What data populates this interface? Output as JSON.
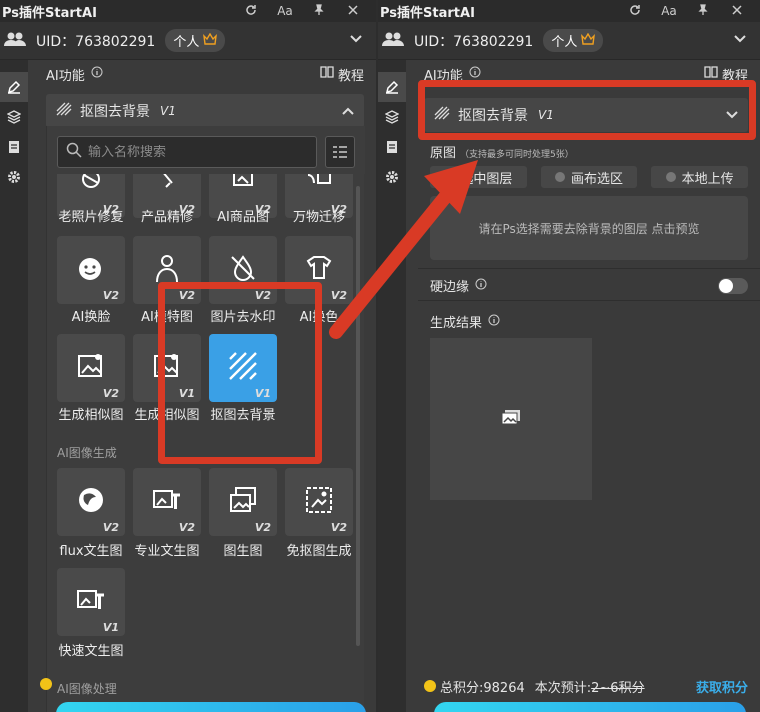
{
  "app": {
    "title": "Ps插件StartAI",
    "uid": "UID：763802291",
    "account_type": "个人",
    "section_title": "AI功能",
    "tutorial": "教程"
  },
  "left": {
    "dropdown": {
      "label": "抠图去背景",
      "version": "V1"
    },
    "search_placeholder": "输入名称搜索",
    "tools": [
      {
        "label": "老照片修复",
        "ver": "V2",
        "icon": "photo-restore-icon"
      },
      {
        "label": "产品精修",
        "ver": "V2",
        "icon": "product-retouch-icon"
      },
      {
        "label": "AI商品图",
        "ver": "V2",
        "icon": "product-image-icon"
      },
      {
        "label": "万物迁移",
        "ver": "V2",
        "icon": "object-transfer-icon"
      },
      {
        "label": "AI换脸",
        "ver": "V2",
        "icon": "face-swap-icon"
      },
      {
        "label": "AI模特图",
        "ver": "V2",
        "icon": "model-photo-icon"
      },
      {
        "label": "图片去水印",
        "ver": "V2",
        "icon": "watermark-remove-icon"
      },
      {
        "label": "AI换色",
        "ver": "V2",
        "icon": "recolor-icon"
      },
      {
        "label": "生成相似图",
        "ver": "V2",
        "icon": "similar-image-icon"
      },
      {
        "label": "生成相似图",
        "ver": "V1",
        "icon": "similar-image-icon"
      },
      {
        "label": "抠图去背景",
        "ver": "V1",
        "icon": "background-remove-icon"
      }
    ],
    "group_gen": "AI图像生成",
    "gen_tools": [
      {
        "label": "flux文生图",
        "ver": "V2",
        "icon": "flux-icon"
      },
      {
        "label": "专业文生图",
        "ver": "V2",
        "icon": "text-to-image-icon"
      },
      {
        "label": "图生图",
        "ver": "V2",
        "icon": "image-to-image-icon"
      },
      {
        "label": "免抠图生成",
        "ver": "V2",
        "icon": "no-cutout-icon"
      },
      {
        "label": "快速文生图",
        "ver": "V1",
        "icon": "quick-text-to-image-icon"
      }
    ],
    "group_proc": "AI图像处理"
  },
  "right": {
    "dropdown": {
      "label": "抠图去背景",
      "version": "V1"
    },
    "original": "原图",
    "original_note": "（支持最多可同时处理5张）",
    "source_options": [
      "选中图层",
      "画布选区",
      "本地上传"
    ],
    "upload_hint": "请在Ps选择需要去除背景的图层 点击预览",
    "hard_edge": "硬边缘",
    "result": "生成结果"
  },
  "footer": {
    "total_points": "总积分:98264",
    "estimate_label": "本次预计:",
    "estimate_value": "2~6积分",
    "get_points": "获取积分"
  },
  "colors": {
    "accent": "#3aa0e6",
    "annotation": "#d93a25",
    "coin": "#f2c318"
  }
}
